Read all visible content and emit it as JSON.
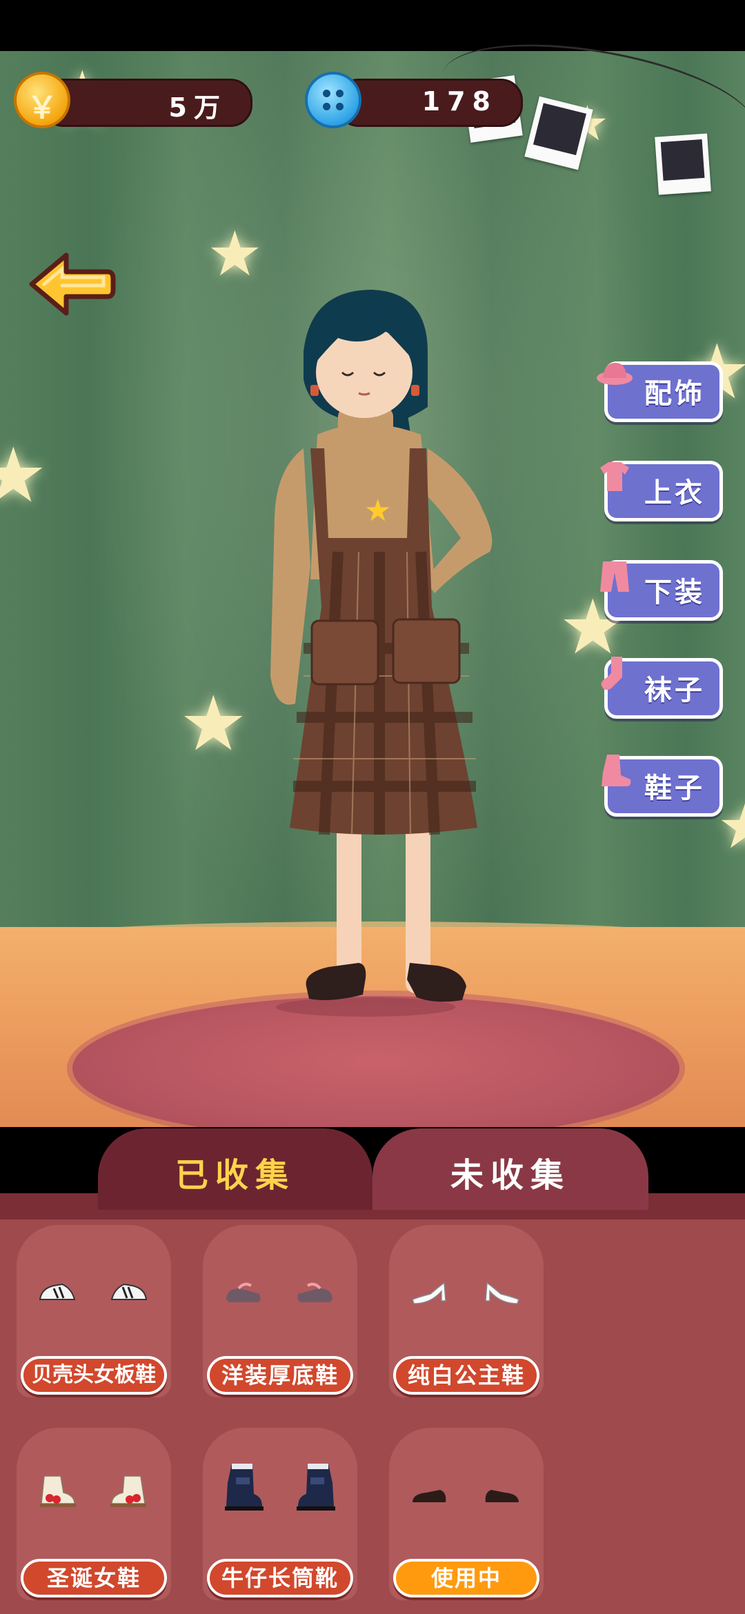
{
  "currency": {
    "coins": "5万",
    "buttons": "178",
    "coin_symbol": "￥"
  },
  "categories": [
    {
      "label": "配饰",
      "icon": "hat-icon"
    },
    {
      "label": "上衣",
      "icon": "shirt-icon"
    },
    {
      "label": "下装",
      "icon": "pants-icon"
    },
    {
      "label": "袜子",
      "icon": "sock-icon"
    },
    {
      "label": "鞋子",
      "icon": "boot-icon"
    }
  ],
  "tabs": {
    "collected": "已收集",
    "uncollected": "未收集"
  },
  "items": [
    {
      "name": "贝壳头女板鞋",
      "icon": "sneaker-icon"
    },
    {
      "name": "洋装厚底鞋",
      "icon": "mary-jane-icon"
    },
    {
      "name": "纯白公主鞋",
      "icon": "heel-icon"
    },
    {
      "name": "圣诞女鞋",
      "icon": "christmas-shoe-icon"
    },
    {
      "name": "牛仔长筒靴",
      "icon": "boot-icon"
    },
    {
      "name": "使用中",
      "icon": "loafer-icon",
      "in_use": true
    }
  ],
  "colors": {
    "curtain": "#557f5c",
    "category_plate": "#6f71cf",
    "panel": "#9f4a4c",
    "active_tab_text": "#ffd34b",
    "item_label": "#d1482d",
    "in_use_label": "#ff9a0e"
  }
}
